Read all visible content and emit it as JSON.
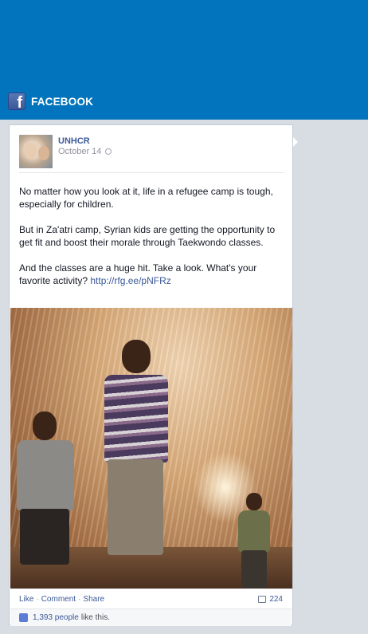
{
  "header": {
    "brand_label": "FACEBOOK",
    "logo_glyph": "f"
  },
  "post": {
    "author": "UNHCR",
    "date": "October 14",
    "paragraphs": [
      "No matter how you look at it, life in a refugee camp is tough, especially for children.",
      "But in Za'atri camp, Syrian kids are getting the opportunity to get fit and boost their morale through Taekwondo classes."
    ],
    "paragraph3_text": "And the classes are a huge hit. Take a look. What's your favorite activity? ",
    "link": "http://rfg.ee/pNFRz"
  },
  "actions": {
    "like": "Like",
    "comment": "Comment",
    "share": "Share",
    "comment_count": "224"
  },
  "likes": {
    "count": "1,393 people",
    "suffix": "like this."
  },
  "colors": {
    "header_blue": "#0274bd",
    "link_blue": "#3b5998"
  }
}
